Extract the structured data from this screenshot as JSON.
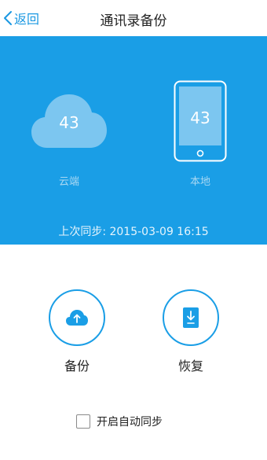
{
  "header": {
    "back_label": "返回",
    "title": "通讯录备份"
  },
  "cloud": {
    "count": "43",
    "label": "云端"
  },
  "local": {
    "count": "43",
    "label": "本地"
  },
  "last_sync": "上次同步: 2015-03-09 16:15",
  "actions": {
    "backup_label": "备份",
    "restore_label": "恢复"
  },
  "auto_sync": {
    "label": "开启自动同步",
    "checked": false
  },
  "colors": {
    "accent": "#1a9ee6",
    "back_text": "#1a98e2",
    "cloud_fill": "#7cc6f0",
    "phone_fill": "#7cc6f0"
  }
}
